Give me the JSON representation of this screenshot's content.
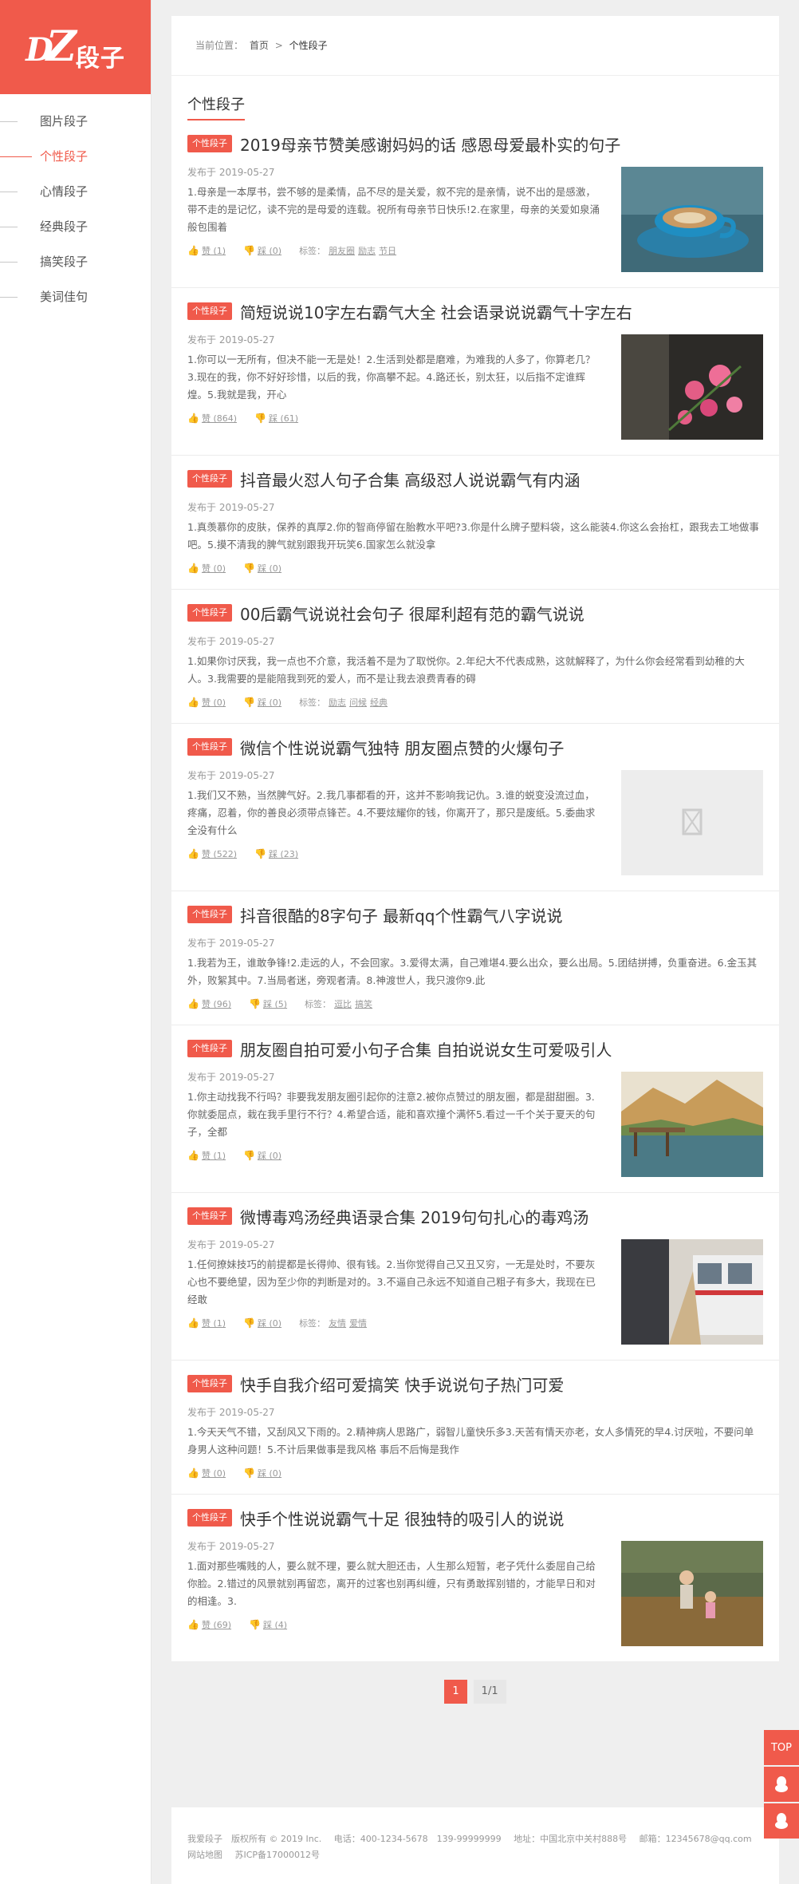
{
  "logo": {
    "brand": "DZ",
    "text": "段子"
  },
  "nav": [
    "图片段子",
    "个性段子",
    "心情段子",
    "经典段子",
    "搞笑段子",
    "美词佳句"
  ],
  "breadcrumb": {
    "prefix": "当前位置：",
    "home": "首页",
    "sep": ">",
    "current": "个性段子"
  },
  "list_title": "个性段子",
  "articles": [
    {
      "badge": "个性段子",
      "title": "2019母亲节赞美感谢妈妈的话 感恩母爱最朴实的句子",
      "date": "发布于 2019-05-27",
      "summary": "1.母亲是一本厚书，尝不够的是柔情，品不尽的是关爱，叙不完的是亲情，说不出的是感激，带不走的是记忆，读不完的是母爱的连载。祝所有母亲节日快乐!2.在家里，母亲的关爱如泉涌般包围着",
      "like": "赞 (1)",
      "dislike": "踩 (0)",
      "tags_label": "标签：",
      "tags": [
        "朋友圈",
        "励志",
        "节日"
      ],
      "image": "coffee"
    },
    {
      "badge": "个性段子",
      "title": "简短说说10字左右霸气大全 社会语录说说霸气十字左右",
      "date": "发布于 2019-05-27",
      "summary": "1.你可以一无所有，但决不能一无是处！2.生活到处都是磨难，为难我的人多了，你算老几？3.现在的我，你不好好珍惜，以后的我，你高攀不起。4.路还长，别太狂，以后指不定谁辉煌。5.我就是我，开心",
      "like": "赞 (864)",
      "dislike": "踩 (61)",
      "tags_label": "",
      "tags": [],
      "image": "roses"
    },
    {
      "badge": "个性段子",
      "title": "抖音最火怼人句子合集 高级怼人说说霸气有内涵",
      "date": "发布于 2019-05-27",
      "summary": "1.真羡慕你的皮肤，保养的真厚2.你的智商停留在胎教水平吧?3.你是什么牌子塑料袋，这么能装4.你这么会抬杠，跟我去工地做事吧。5.摸不清我的脾气就别跟我开玩笑6.国家怎么就没拿",
      "like": "赞 (0)",
      "dislike": "踩 (0)",
      "tags_label": "",
      "tags": [],
      "image": ""
    },
    {
      "badge": "个性段子",
      "title": "00后霸气说说社会句子 很犀利超有范的霸气说说",
      "date": "发布于 2019-05-27",
      "summary": "1.如果你讨厌我，我一点也不介意，我活着不是为了取悦你。2.年纪大不代表成熟，这就解释了，为什么你会经常看到幼稚的大人。3.我需要的是能陪我到死的爱人，而不是让我去浪费青春的碍",
      "like": "赞 (0)",
      "dislike": "踩 (0)",
      "tags_label": "标签：",
      "tags": [
        "励志",
        "问候",
        "经典"
      ],
      "image": ""
    },
    {
      "badge": "个性段子",
      "title": "微信个性说说霸气独特 朋友圈点赞的火爆句子",
      "date": "发布于 2019-05-27",
      "summary": "1.我们又不熟，当然脾气好。2.我几事都看的开，这并不影响我记仇。3.谁的蜕变没流过血，疼痛，忍着，你的善良必须带点锋芒。4.不要炫耀你的钱，你离开了，那只是废纸。5.委曲求全没有什么",
      "like": "赞 (522)",
      "dislike": "踩 (23)",
      "tags_label": "",
      "tags": [],
      "image": "placeholder"
    },
    {
      "badge": "个性段子",
      "title": "抖音很酷的8字句子 最新qq个性霸气八字说说",
      "date": "发布于 2019-05-27",
      "summary": "1.我若为王，谁敢争锋!2.走远的人，不会回家。3.爱得太满，自己难堪4.要么出众，要么出局。5.团结拼搏，负重奋进。6.金玉其外，败絮其中。7.当局者迷，旁观者清。8.神渡世人，我只渡你9.此",
      "like": "赞 (96)",
      "dislike": "踩 (5)",
      "tags_label": "标签：",
      "tags": [
        "逗比",
        "搞笑"
      ],
      "image": ""
    },
    {
      "badge": "个性段子",
      "title": "朋友圈自拍可爱小句子合集 自拍说说女生可爱吸引人",
      "date": "发布于 2019-05-27",
      "summary": "1.你主动找我不行吗？非要我发朋友圈引起你的注意2.被你点赞过的朋友圈，都是甜甜圈。3.你就委屈点，栽在我手里行不行？4.希望合适，能和喜欢撞个满怀5.看过一千个关于夏天的句子，全都",
      "like": "赞 (1)",
      "dislike": "踩 (0)",
      "tags_label": "",
      "tags": [],
      "image": "lake"
    },
    {
      "badge": "个性段子",
      "title": "微博毒鸡汤经典语录合集 2019句句扎心的毒鸡汤",
      "date": "发布于 2019-05-27",
      "summary": "1.任何撩妹技巧的前提都是长得帅、很有钱。2.当你觉得自己又丑又穷，一无是处时，不要灰心也不要绝望，因为至少你的判断是对的。3.不逼自己永远不知道自己粗子有多大，我现在已经敢",
      "like": "赞 (1)",
      "dislike": "踩 (0)",
      "tags_label": "标签：",
      "tags": [
        "友情",
        "爱情"
      ],
      "image": "train"
    },
    {
      "badge": "个性段子",
      "title": "快手自我介绍可爱搞笑 快手说说句子热门可爱",
      "date": "发布于 2019-05-27",
      "summary": "1.今天天气不错，又刮风又下雨的。2.精神病人思路广，弱智儿童快乐多3.天苦有情天亦老，女人多情死的早4.讨厌啦，不要问单身男人这种问题！5.不计后果做事是我风格 事后不后悔是我作",
      "like": "赞 (0)",
      "dislike": "踩 (0)",
      "tags_label": "",
      "tags": [],
      "image": ""
    },
    {
      "badge": "个性段子",
      "title": "快手个性说说霸气十足 很独特的吸引人的说说",
      "date": "发布于 2019-05-27",
      "summary": "1.面对那些嘴贱的人，要么就不理，要么就大胆还击，人生那么短暂，老子凭什么委屈自己给你脸。2.错过的风景就别再留恋，离开的过客也别再纠缠，只有勇敢挥别错的，才能早日和对的相逢。3.",
      "like": "赞 (69)",
      "dislike": "踩 (4)",
      "tags_label": "",
      "tags": [],
      "image": "kids"
    }
  ],
  "pager": {
    "current": "1",
    "total": "1/1"
  },
  "footer": {
    "copyright": "我爱段子　版权所有 © 2019 Inc.",
    "phone": "电话：400-1234-5678　139-99999999",
    "address": "地址：中国北京中关村888号",
    "email": "邮箱：12345678@qq.com",
    "sitemap": "网站地图",
    "icp": "苏ICP备17000012号"
  },
  "side_tools": {
    "top": "TOP"
  },
  "colors": {
    "accent": "#f05a4b"
  }
}
